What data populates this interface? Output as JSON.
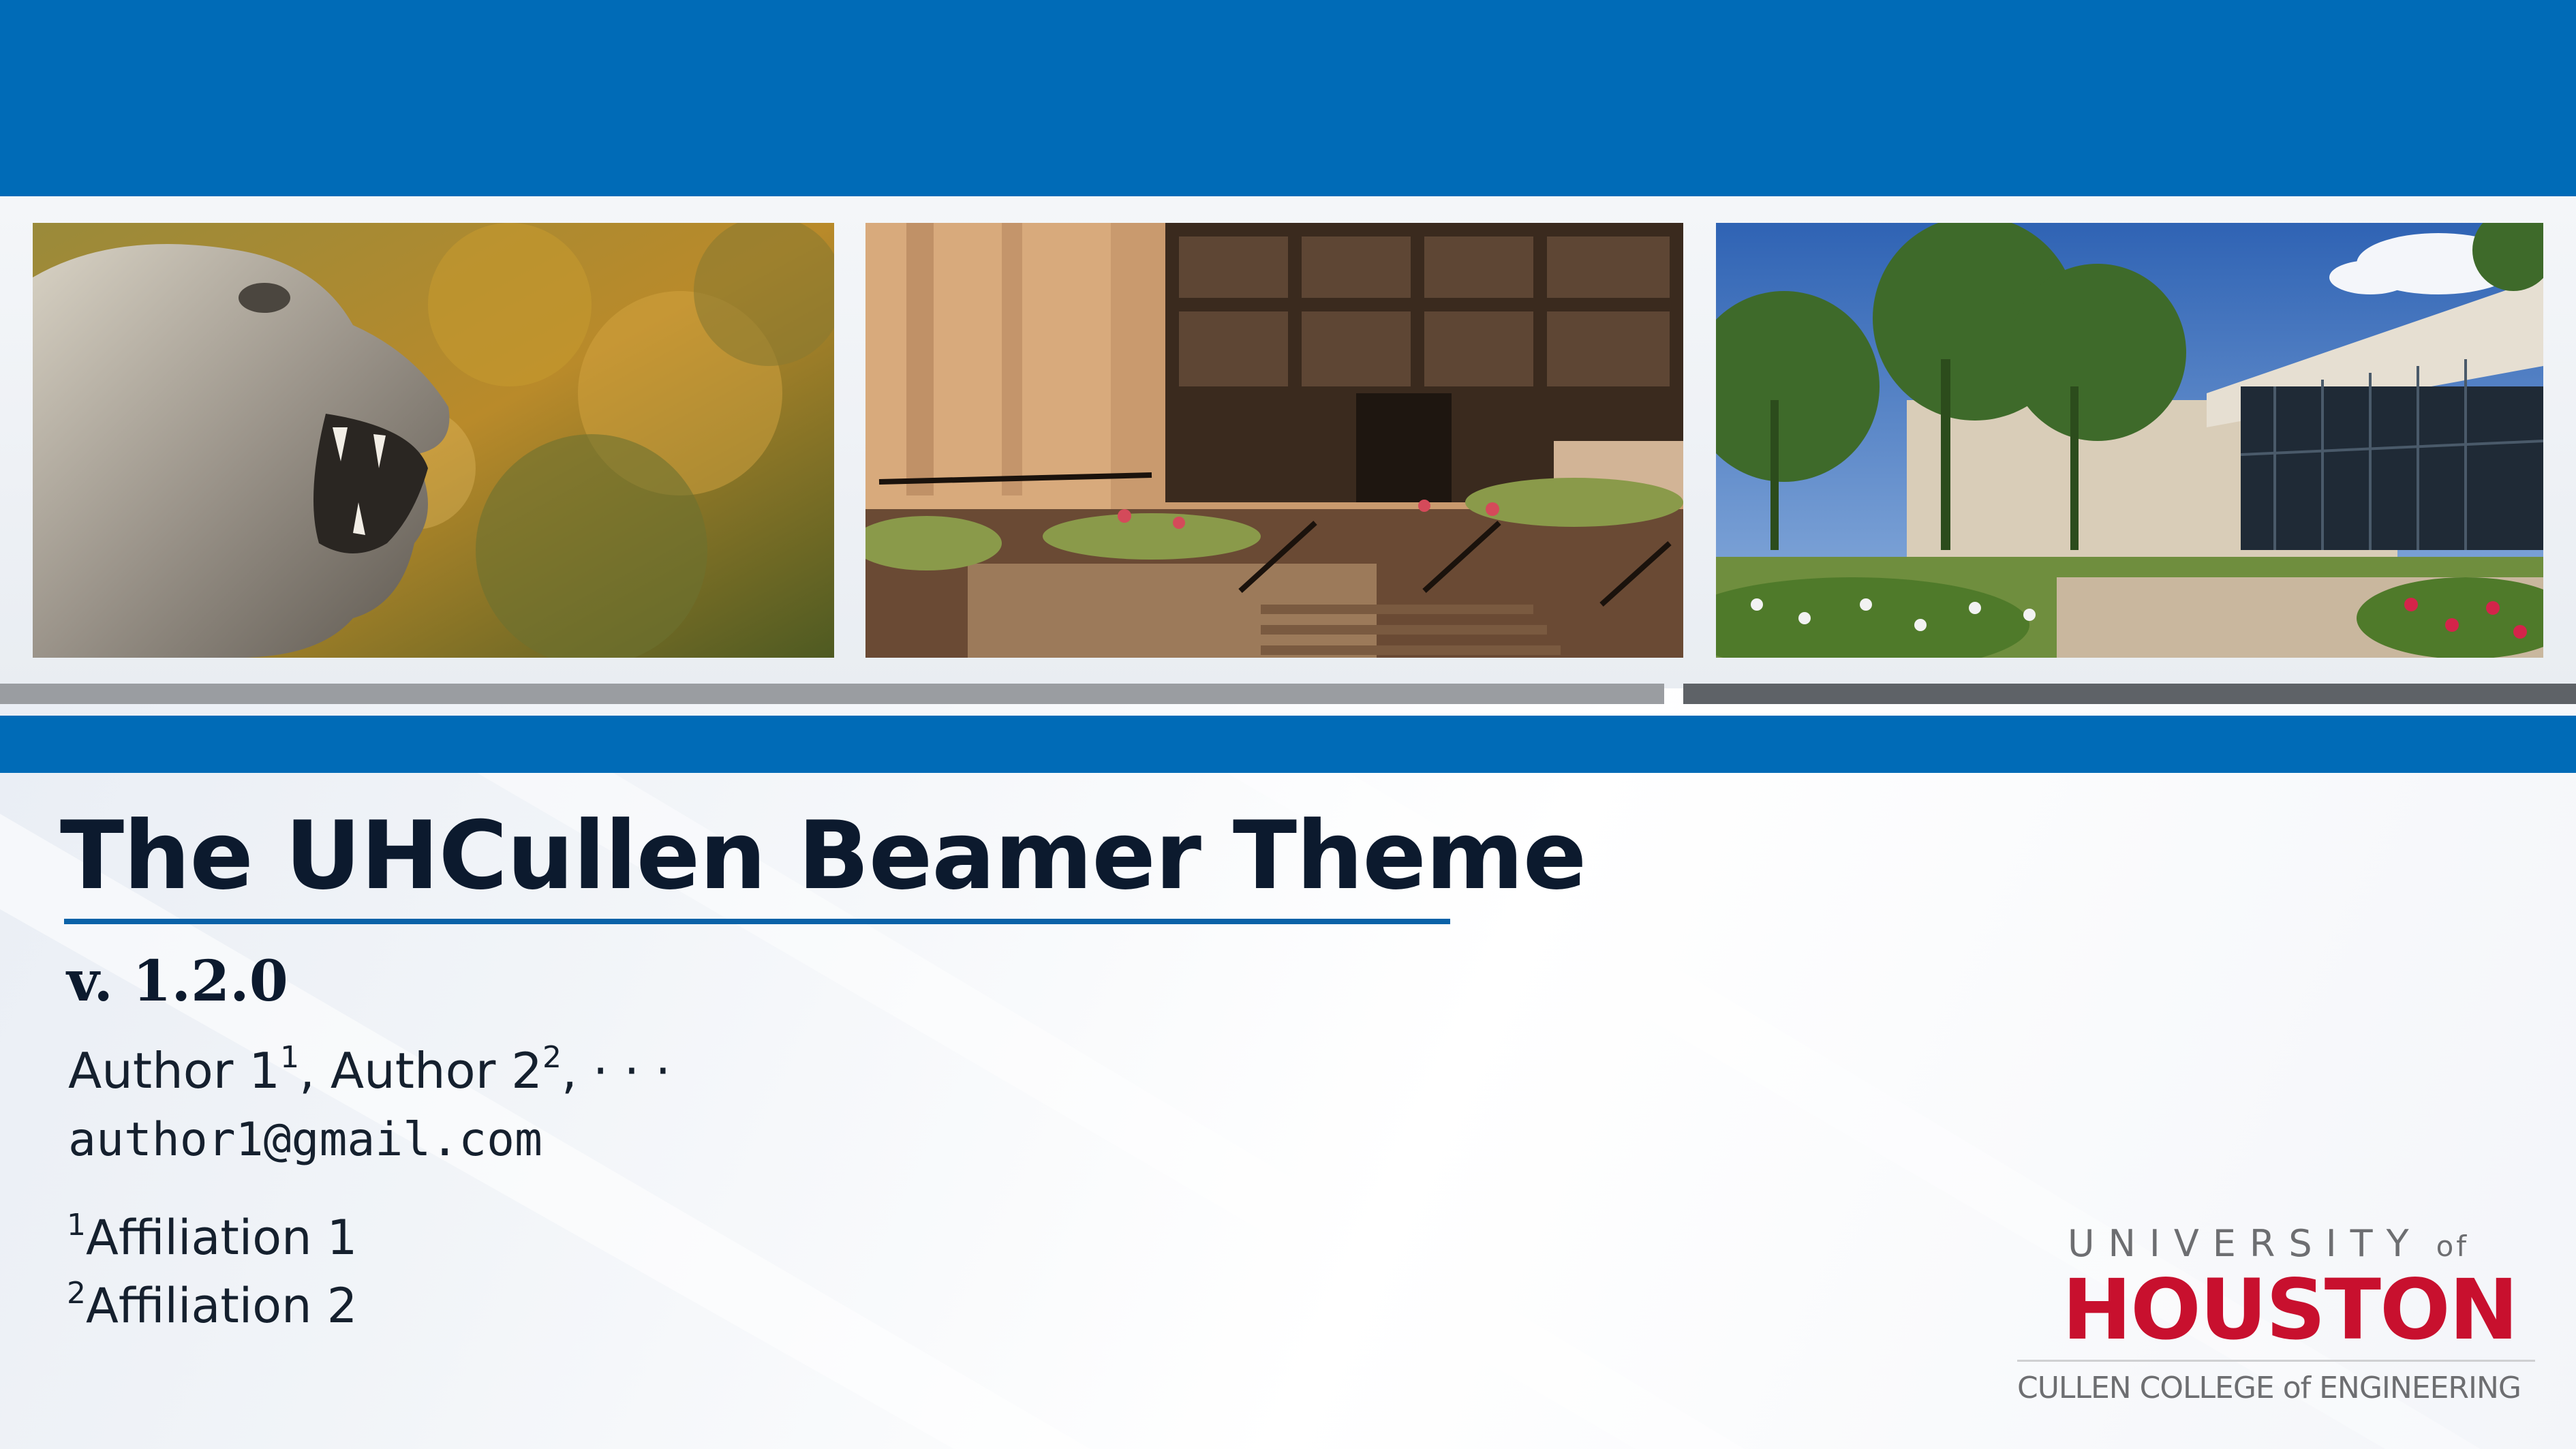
{
  "colors": {
    "uh_blue": "#006bb7",
    "uh_red": "#c8102e",
    "logo_gray": "#6d6e71",
    "title_text": "#0c1a2e"
  },
  "slide": {
    "title": "The UHCullen Beamer Theme",
    "subtitle": "v. 1.2.0",
    "authors": [
      {
        "name": "Author 1",
        "mark": "1",
        "sep": ", "
      },
      {
        "name": "Author 2",
        "mark": "2",
        "sep": ", "
      }
    ],
    "authors_more": "· · ·",
    "email": "author1@gmail.com",
    "affiliations": [
      {
        "mark": "1",
        "name": "Affiliation 1"
      },
      {
        "mark": "2",
        "name": "Affiliation 2"
      }
    ]
  },
  "photos": [
    {
      "icon": "cougar-statue-photo"
    },
    {
      "icon": "cullen-college-entrance-photo"
    },
    {
      "icon": "engineering-building-photo"
    }
  ],
  "logo": {
    "line1": "UNIVERSITY",
    "line1_of": "of",
    "line2": "HOUSTON",
    "line3": "CULLEN COLLEGE of ENGINEERING"
  }
}
